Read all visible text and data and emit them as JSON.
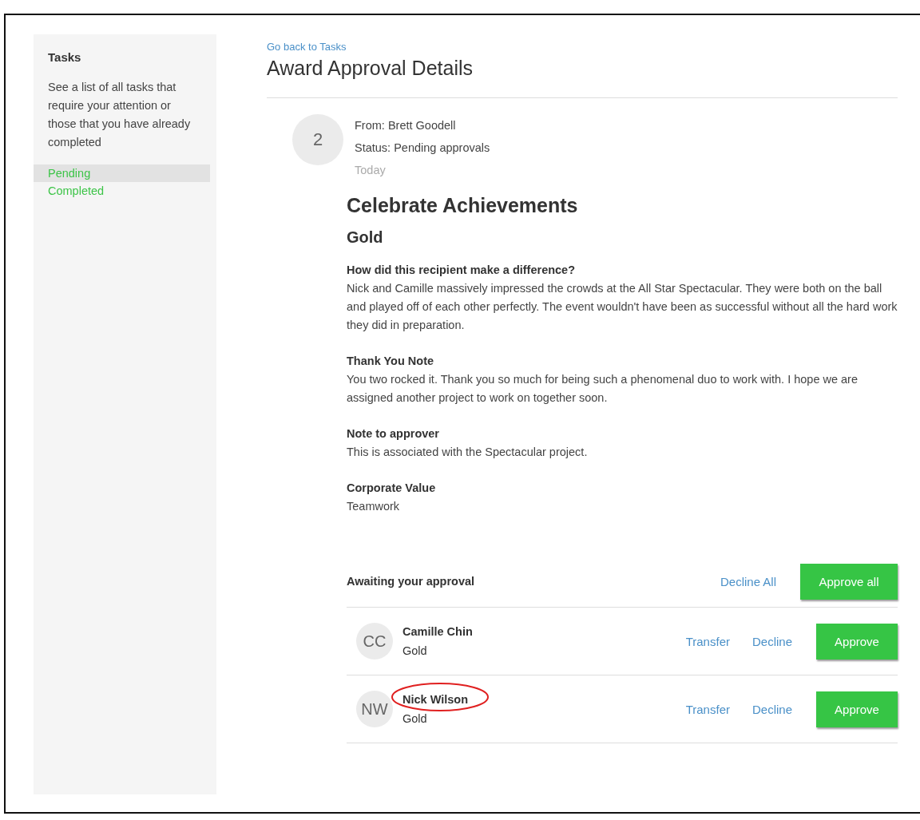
{
  "sidebar": {
    "title": "Tasks",
    "description": "See a list of all tasks that require your attention or those that you have already completed",
    "items": [
      {
        "label": "Pending",
        "selected": true
      },
      {
        "label": "Completed",
        "selected": false
      }
    ]
  },
  "header": {
    "back_link": "Go back to Tasks",
    "title": "Award Approval Details"
  },
  "task": {
    "count": "2",
    "from": "From: Brett Goodell",
    "status": "Status: Pending approvals",
    "date": "Today",
    "program": "Celebrate Achievements",
    "level": "Gold",
    "sections": [
      {
        "heading": "How did this recipient make a difference?",
        "body": "Nick and Camille massively impressed the crowds at the All Star Spectacular. They were both on the ball and played off of each other perfectly. The event wouldn't have been as successful without all the hard work they did in preparation."
      },
      {
        "heading": "Thank You Note",
        "body": "You two rocked it. Thank you so much for being such a phenomenal duo to work with. I hope we are assigned another project to work on together soon."
      },
      {
        "heading": "Note to approver",
        "body": "This is associated with the Spectacular project."
      },
      {
        "heading": "Corporate Value",
        "body": "Teamwork"
      }
    ]
  },
  "approval": {
    "label": "Awaiting your approval",
    "decline_all": "Decline All",
    "approve_all": "Approve all",
    "recipients": [
      {
        "initials": "CC",
        "name": "Camille Chin",
        "level": "Gold",
        "transfer": "Transfer",
        "decline": "Decline",
        "approve": "Approve",
        "circled": false
      },
      {
        "initials": "NW",
        "name": "Nick Wilson",
        "level": "Gold",
        "transfer": "Transfer",
        "decline": "Decline",
        "approve": "Approve",
        "circled": true
      }
    ]
  }
}
